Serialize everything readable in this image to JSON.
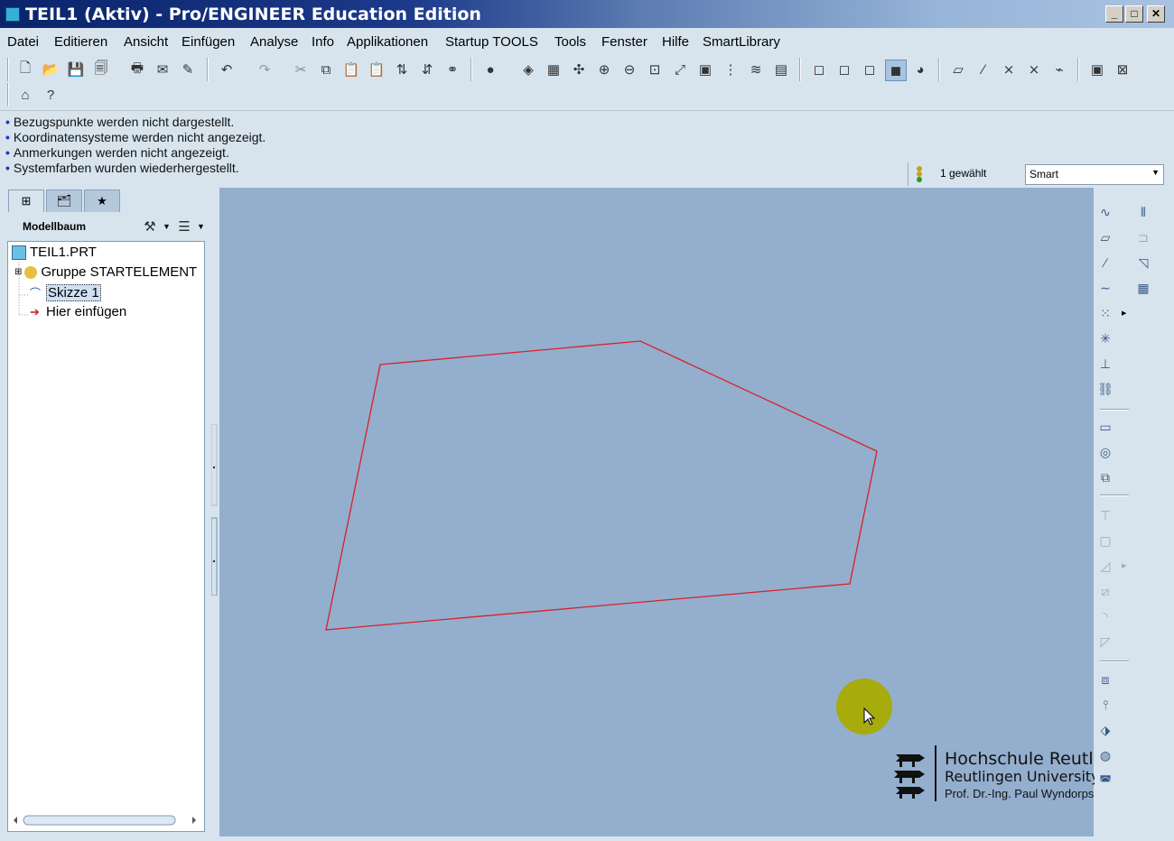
{
  "window": {
    "title": "TEIL1 (Aktiv) - Pro/ENGINEER Education Edition",
    "controls": [
      "_",
      "□",
      "✕"
    ]
  },
  "menubar": [
    "Datei",
    "Editieren",
    "Ansicht",
    "Einfügen",
    "Analyse",
    "Info",
    "Applikationen",
    "Startup TOOLS",
    "Tools",
    "Fenster",
    "Hilfe",
    "SmartLibrary"
  ],
  "messages": [
    "Bezugspunkte werden nicht dargestellt.",
    "Koordinatensysteme werden nicht angezeigt.",
    "Anmerkungen werden nicht angezeigt.",
    "Systemfarben wurden wiederhergestellt."
  ],
  "status": {
    "selected": "1 gewählt",
    "filter": "Smart"
  },
  "navigator": {
    "header": "Modellbaum",
    "tree": [
      {
        "label": "TEIL1.PRT"
      },
      {
        "label": "Gruppe STARTELEMENT"
      },
      {
        "label": "Skizze 1"
      },
      {
        "label": "Hier einfügen"
      }
    ]
  },
  "sketch": {
    "color": "#d8202a",
    "selected_item": "Skizze 1"
  },
  "logo": {
    "line1": "Hochschule Reutlingen",
    "line2": "Reutlingen University",
    "line3": "Prof. Dr.-Ing. Paul Wyndorps"
  },
  "colors": {
    "graphics_bg": "#94aecd",
    "ui_bg": "#d7e4ee",
    "cursor_highlight": "#a7ab0c"
  }
}
